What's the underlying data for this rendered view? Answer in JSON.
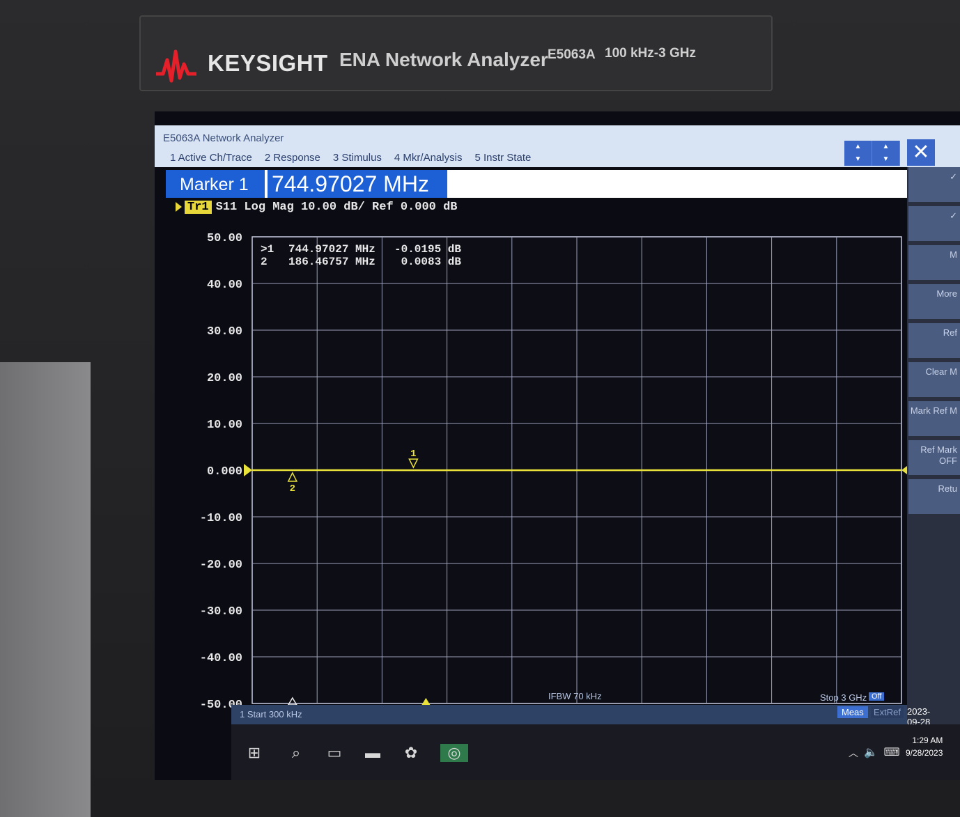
{
  "device": {
    "brand": "KEYSIGHT",
    "product": "ENA Network Analyzer",
    "model": "E5063A",
    "range": "100 kHz-3 GHz"
  },
  "window": {
    "title": "E5063A Network Analyzer",
    "menu": [
      "1 Active Ch/Trace",
      "2 Response",
      "3 Stimulus",
      "4 Mkr/Analysis",
      "5 Instr State"
    ],
    "close_glyph": "✕"
  },
  "entry": {
    "label": "Marker 1",
    "value": "744.97027 MHz"
  },
  "trace": {
    "badge": "Tr1",
    "header": "S11 Log Mag 10.00 dB/ Ref 0.000 dB",
    "color": "#e8e23a"
  },
  "markers": [
    {
      "indicator": ">1",
      "freq": "744.97027 MHz",
      "value": "-0.0195 dB",
      "label": "1"
    },
    {
      "indicator": "2",
      "freq": "186.46757 MHz",
      "value": "0.0083 dB",
      "label": "2"
    }
  ],
  "chart_data": {
    "type": "line",
    "title": "S11 Log Mag 10.00 dB/ Ref 0.000 dB",
    "ylim": [
      -50,
      50
    ],
    "yticks": [
      "50.00",
      "40.00",
      "30.00",
      "20.00",
      "10.00",
      "0.000",
      "-10.00",
      "-20.00",
      "-30.00",
      "-40.00",
      "-50.00"
    ],
    "xlim_mhz": [
      0.3,
      3000
    ],
    "grid": true,
    "series": [
      {
        "x": [
          0.3,
          186.46757,
          744.97027,
          3000
        ],
        "y": [
          0.0,
          0.0083,
          -0.0195,
          0.0
        ]
      }
    ]
  },
  "status": {
    "start": "1  Start 300 kHz",
    "ifbw": "IFBW 70 kHz",
    "stop": "Stop 3 GHz",
    "off": "Off",
    "meas": "Meas",
    "extref": "ExtRef",
    "date": "2023-09-28"
  },
  "softkeys": [
    "✓",
    "✓",
    "M",
    "More",
    "Ref",
    "Clear M",
    "Mark Ref M",
    "Ref Mark OFF",
    "Retu"
  ],
  "taskbar": {
    "time": "1:29 AM",
    "date": "9/28/2023"
  }
}
